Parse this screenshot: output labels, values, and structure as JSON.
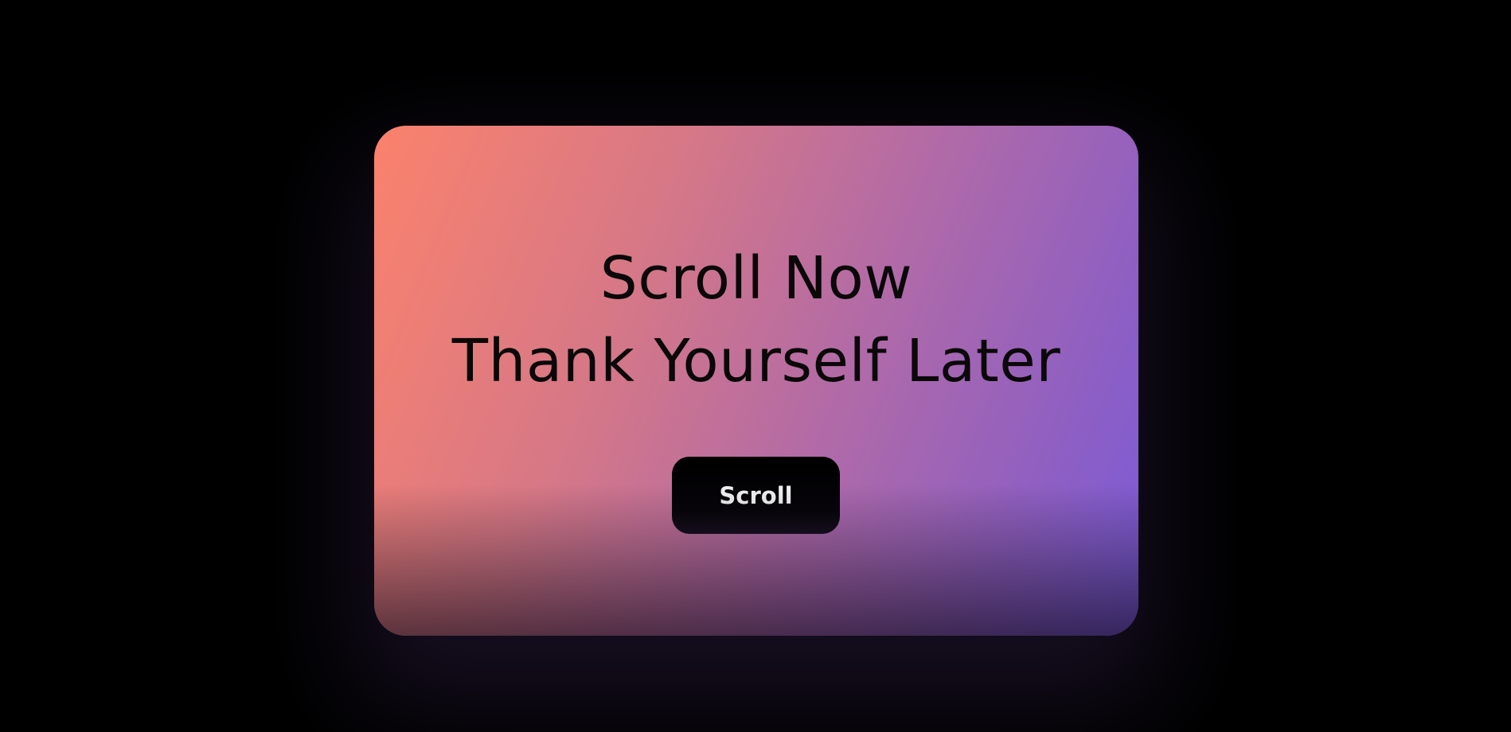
{
  "hero": {
    "headline_line1": "Scroll Now",
    "headline_line2": "Thank Yourself Later",
    "button_label": "Scroll"
  },
  "colors": {
    "background": "#000000",
    "gradient_start": "#fb826c",
    "gradient_end": "#7a5ad8",
    "button_background": "#000000",
    "button_text": "#f2f2f2",
    "headline_text": "#0a0808"
  }
}
